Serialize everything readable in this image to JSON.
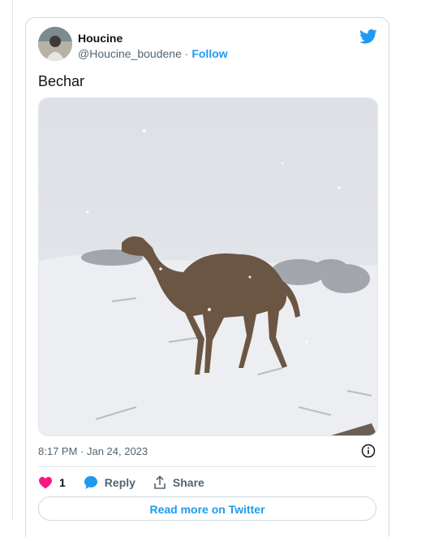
{
  "author": {
    "name": "Houcine",
    "handle": "@Houcine_boudene",
    "separator": "·",
    "follow_label": "Follow",
    "avatar_icon": "user-avatar"
  },
  "tweet": {
    "text": "Bechar",
    "media_icon": "camel-in-snow-video-thumbnail",
    "timestamp": "8:17 PM · Jan 24, 2023"
  },
  "actions": {
    "like_count": "1",
    "reply_label": "Reply",
    "share_label": "Share"
  },
  "footer": {
    "read_more_label": "Read more on Twitter"
  },
  "colors": {
    "brand": "#1d9bf0",
    "like": "#f91880",
    "border": "#cfd9de"
  }
}
